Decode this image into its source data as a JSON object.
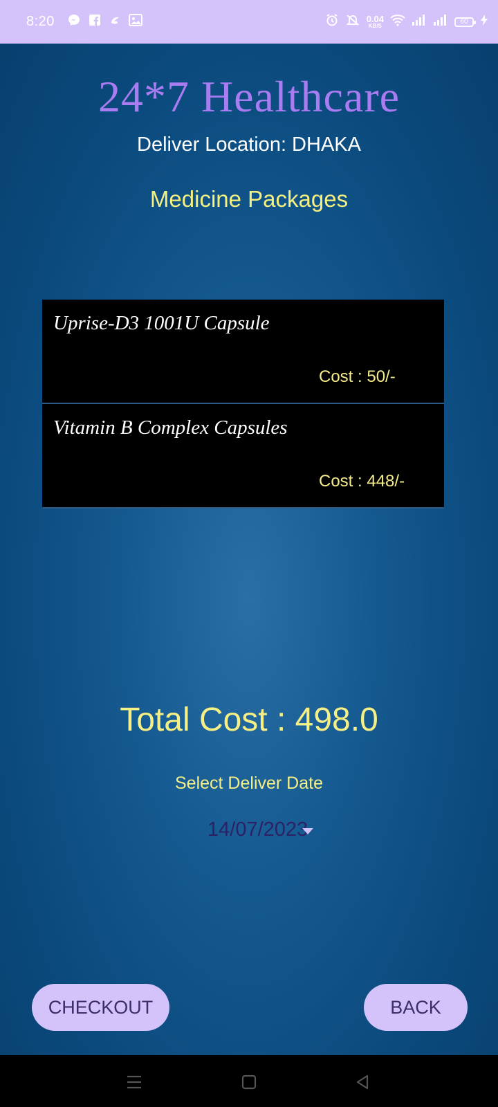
{
  "status_bar": {
    "time": "8:20",
    "left_icons": [
      "messenger-icon",
      "facebook-icon",
      "chat-icon",
      "photo-icon"
    ],
    "net_speed_value": "0.04",
    "net_speed_unit": "KB/S",
    "battery_level": "60",
    "right_icons": [
      "alarm-icon",
      "mute-icon",
      "wifi-icon",
      "signal-icon",
      "signal-icon",
      "battery-icon",
      "charging-icon"
    ]
  },
  "app": {
    "title": "24*7 Healthcare",
    "deliver_location": "Deliver Location: DHAKA",
    "section_title": "Medicine Packages"
  },
  "packages": [
    {
      "name": "Uprise-D3 1001U Capsule",
      "cost": "Cost : 50/-"
    },
    {
      "name": "Vitamin B Complex Capsules",
      "cost": "Cost : 448/-"
    }
  ],
  "summary": {
    "total_cost": "Total Cost : 498.0",
    "select_date_label": "Select Deliver Date",
    "selected_date": "14/07/2023"
  },
  "buttons": {
    "checkout": "CHECKOUT",
    "back": "BACK"
  },
  "colors": {
    "accent_purple": "#d4c2fb",
    "title_purple": "#a97cf2",
    "highlight_yellow": "#f5ef86",
    "background_blue": "#0b4a7a"
  }
}
